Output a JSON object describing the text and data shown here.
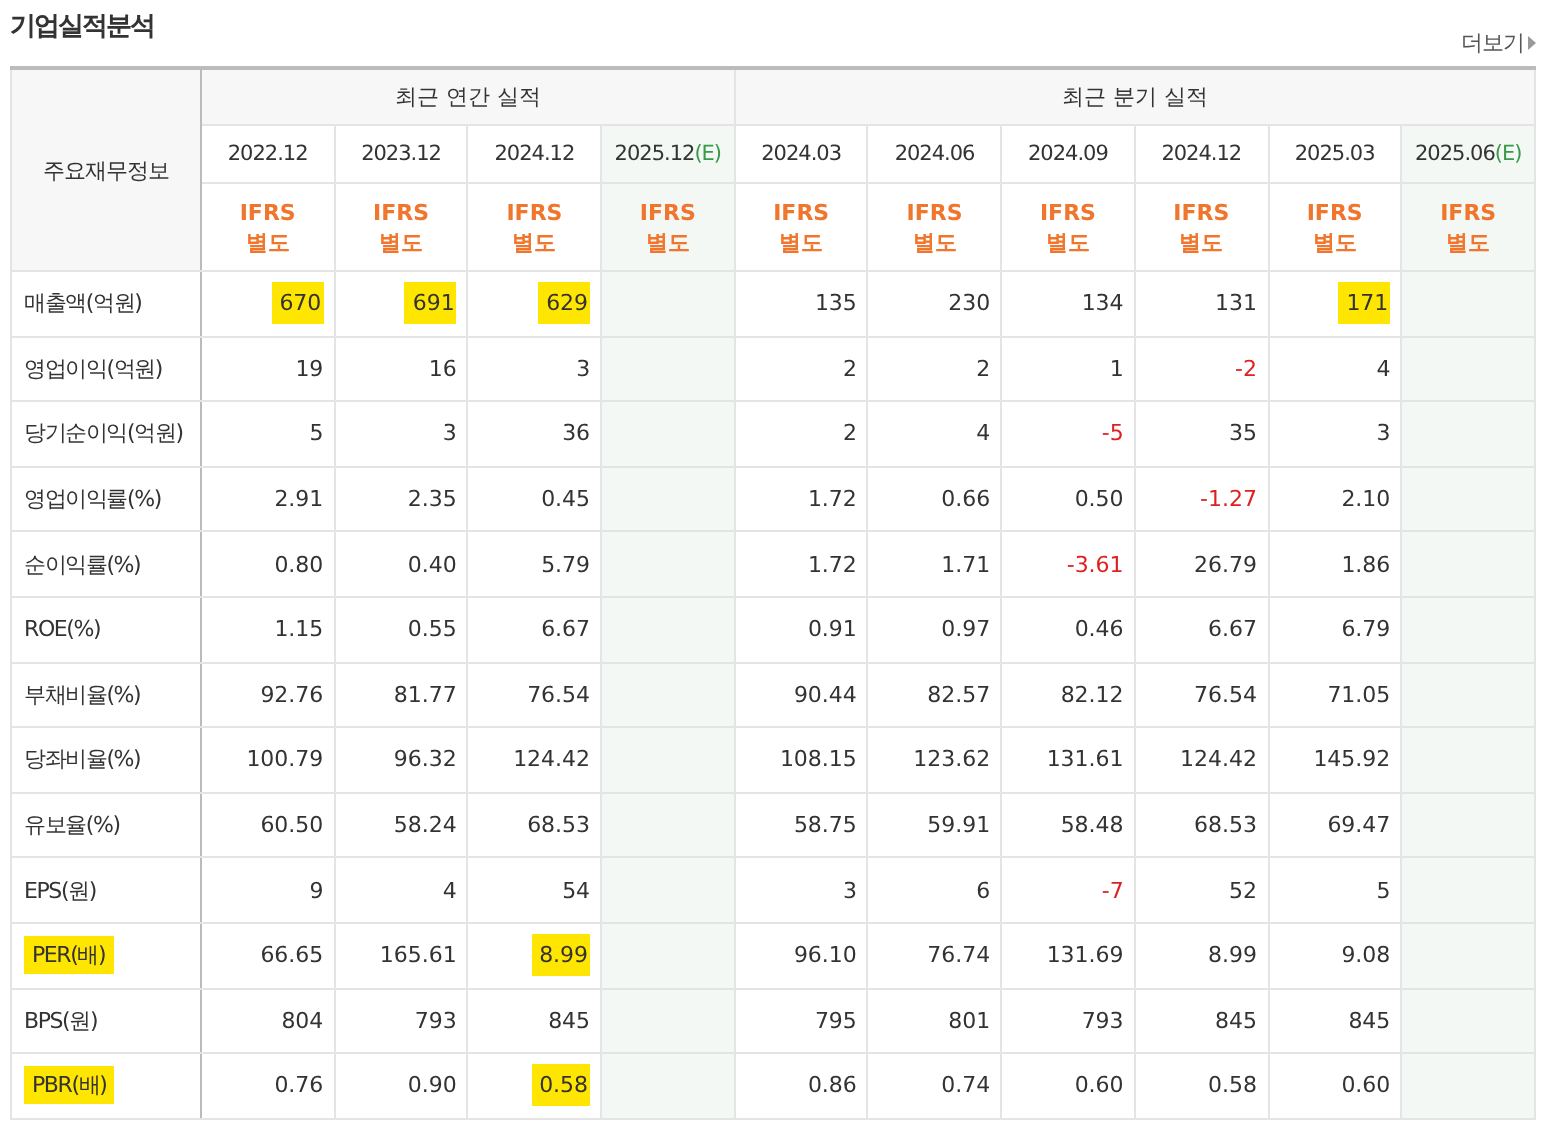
{
  "title": "기업실적분석",
  "more_link": "더보기",
  "corner_label": "주요재무정보",
  "groups": [
    {
      "label": "최근 연간 실적",
      "columns": [
        {
          "period": "2022.12",
          "estimate": false,
          "standard": [
            "IFRS",
            "별도"
          ]
        },
        {
          "period": "2023.12",
          "estimate": false,
          "standard": [
            "IFRS",
            "별도"
          ]
        },
        {
          "period": "2024.12",
          "estimate": false,
          "standard": [
            "IFRS",
            "별도"
          ]
        },
        {
          "period": "2025.12",
          "suffix": "(E)",
          "estimate": true,
          "standard": [
            "IFRS",
            "별도"
          ]
        }
      ]
    },
    {
      "label": "최근 분기 실적",
      "columns": [
        {
          "period": "2024.03",
          "estimate": false,
          "standard": [
            "IFRS",
            "별도"
          ]
        },
        {
          "period": "2024.06",
          "estimate": false,
          "standard": [
            "IFRS",
            "별도"
          ]
        },
        {
          "period": "2024.09",
          "estimate": false,
          "standard": [
            "IFRS",
            "별도"
          ]
        },
        {
          "period": "2024.12",
          "estimate": false,
          "standard": [
            "IFRS",
            "별도"
          ]
        },
        {
          "period": "2025.03",
          "estimate": false,
          "standard": [
            "IFRS",
            "별도"
          ]
        },
        {
          "period": "2025.06",
          "suffix": "(E)",
          "estimate": true,
          "standard": [
            "IFRS",
            "별도"
          ]
        }
      ]
    }
  ],
  "row_groups": [
    [
      {
        "label": "매출액(억원)",
        "highlighted": false,
        "values": [
          {
            "text": "670",
            "highlighted": true,
            "negative": false
          },
          {
            "text": "691",
            "highlighted": true,
            "negative": false
          },
          {
            "text": "629",
            "highlighted": true,
            "negative": false
          },
          {
            "text": "135",
            "highlighted": false,
            "negative": false
          },
          {
            "text": "230",
            "highlighted": false,
            "negative": false
          },
          {
            "text": "134",
            "highlighted": false,
            "negative": false
          },
          {
            "text": "131",
            "highlighted": false,
            "negative": false
          },
          {
            "text": "171",
            "highlighted": true,
            "negative": false
          }
        ]
      },
      {
        "label": "영업이익(억원)",
        "highlighted": false,
        "values": [
          {
            "text": "19",
            "highlighted": false,
            "negative": false
          },
          {
            "text": "16",
            "highlighted": false,
            "negative": false
          },
          {
            "text": "3",
            "highlighted": false,
            "negative": false
          },
          {
            "text": "2",
            "highlighted": false,
            "negative": false
          },
          {
            "text": "2",
            "highlighted": false,
            "negative": false
          },
          {
            "text": "1",
            "highlighted": false,
            "negative": false
          },
          {
            "text": "-2",
            "highlighted": false,
            "negative": true
          },
          {
            "text": "4",
            "highlighted": false,
            "negative": false
          }
        ]
      },
      {
        "label": "당기순이익(억원)",
        "highlighted": false,
        "values": [
          {
            "text": "5",
            "highlighted": false,
            "negative": false
          },
          {
            "text": "3",
            "highlighted": false,
            "negative": false
          },
          {
            "text": "36",
            "highlighted": false,
            "negative": false
          },
          {
            "text": "2",
            "highlighted": false,
            "negative": false
          },
          {
            "text": "4",
            "highlighted": false,
            "negative": false
          },
          {
            "text": "-5",
            "highlighted": false,
            "negative": true
          },
          {
            "text": "35",
            "highlighted": false,
            "negative": false
          },
          {
            "text": "3",
            "highlighted": false,
            "negative": false
          }
        ]
      }
    ],
    [
      {
        "label": "영업이익률(%)",
        "highlighted": false,
        "values": [
          {
            "text": "2.91",
            "highlighted": false,
            "negative": false
          },
          {
            "text": "2.35",
            "highlighted": false,
            "negative": false
          },
          {
            "text": "0.45",
            "highlighted": false,
            "negative": false
          },
          {
            "text": "1.72",
            "highlighted": false,
            "negative": false
          },
          {
            "text": "0.66",
            "highlighted": false,
            "negative": false
          },
          {
            "text": "0.50",
            "highlighted": false,
            "negative": false
          },
          {
            "text": "-1.27",
            "highlighted": false,
            "negative": true
          },
          {
            "text": "2.10",
            "highlighted": false,
            "negative": false
          }
        ]
      },
      {
        "label": "순이익률(%)",
        "highlighted": false,
        "values": [
          {
            "text": "0.80",
            "highlighted": false,
            "negative": false
          },
          {
            "text": "0.40",
            "highlighted": false,
            "negative": false
          },
          {
            "text": "5.79",
            "highlighted": false,
            "negative": false
          },
          {
            "text": "1.72",
            "highlighted": false,
            "negative": false
          },
          {
            "text": "1.71",
            "highlighted": false,
            "negative": false
          },
          {
            "text": "-3.61",
            "highlighted": false,
            "negative": true
          },
          {
            "text": "26.79",
            "highlighted": false,
            "negative": false
          },
          {
            "text": "1.86",
            "highlighted": false,
            "negative": false
          }
        ]
      },
      {
        "label": "ROE(%)",
        "highlighted": false,
        "values": [
          {
            "text": "1.15",
            "highlighted": false,
            "negative": false
          },
          {
            "text": "0.55",
            "highlighted": false,
            "negative": false
          },
          {
            "text": "6.67",
            "highlighted": false,
            "negative": false
          },
          {
            "text": "0.91",
            "highlighted": false,
            "negative": false
          },
          {
            "text": "0.97",
            "highlighted": false,
            "negative": false
          },
          {
            "text": "0.46",
            "highlighted": false,
            "negative": false
          },
          {
            "text": "6.67",
            "highlighted": false,
            "negative": false
          },
          {
            "text": "6.79",
            "highlighted": false,
            "negative": false
          }
        ]
      }
    ],
    [
      {
        "label": "부채비율(%)",
        "highlighted": false,
        "values": [
          {
            "text": "92.76",
            "highlighted": false,
            "negative": false
          },
          {
            "text": "81.77",
            "highlighted": false,
            "negative": false
          },
          {
            "text": "76.54",
            "highlighted": false,
            "negative": false
          },
          {
            "text": "90.44",
            "highlighted": false,
            "negative": false
          },
          {
            "text": "82.57",
            "highlighted": false,
            "negative": false
          },
          {
            "text": "82.12",
            "highlighted": false,
            "negative": false
          },
          {
            "text": "76.54",
            "highlighted": false,
            "negative": false
          },
          {
            "text": "71.05",
            "highlighted": false,
            "negative": false
          }
        ]
      },
      {
        "label": "당좌비율(%)",
        "highlighted": false,
        "values": [
          {
            "text": "100.79",
            "highlighted": false,
            "negative": false
          },
          {
            "text": "96.32",
            "highlighted": false,
            "negative": false
          },
          {
            "text": "124.42",
            "highlighted": false,
            "negative": false
          },
          {
            "text": "108.15",
            "highlighted": false,
            "negative": false
          },
          {
            "text": "123.62",
            "highlighted": false,
            "negative": false
          },
          {
            "text": "131.61",
            "highlighted": false,
            "negative": false
          },
          {
            "text": "124.42",
            "highlighted": false,
            "negative": false
          },
          {
            "text": "145.92",
            "highlighted": false,
            "negative": false
          }
        ]
      },
      {
        "label": "유보율(%)",
        "highlighted": false,
        "values": [
          {
            "text": "60.50",
            "highlighted": false,
            "negative": false
          },
          {
            "text": "58.24",
            "highlighted": false,
            "negative": false
          },
          {
            "text": "68.53",
            "highlighted": false,
            "negative": false
          },
          {
            "text": "58.75",
            "highlighted": false,
            "negative": false
          },
          {
            "text": "59.91",
            "highlighted": false,
            "negative": false
          },
          {
            "text": "58.48",
            "highlighted": false,
            "negative": false
          },
          {
            "text": "68.53",
            "highlighted": false,
            "negative": false
          },
          {
            "text": "69.47",
            "highlighted": false,
            "negative": false
          }
        ]
      }
    ],
    [
      {
        "label": "EPS(원)",
        "highlighted": false,
        "values": [
          {
            "text": "9",
            "highlighted": false,
            "negative": false
          },
          {
            "text": "4",
            "highlighted": false,
            "negative": false
          },
          {
            "text": "54",
            "highlighted": false,
            "negative": false
          },
          {
            "text": "3",
            "highlighted": false,
            "negative": false
          },
          {
            "text": "6",
            "highlighted": false,
            "negative": false
          },
          {
            "text": "-7",
            "highlighted": false,
            "negative": true
          },
          {
            "text": "52",
            "highlighted": false,
            "negative": false
          },
          {
            "text": "5",
            "highlighted": false,
            "negative": false
          }
        ]
      },
      {
        "label": "PER(배)",
        "highlighted": true,
        "values": [
          {
            "text": "66.65",
            "highlighted": false,
            "negative": false
          },
          {
            "text": "165.61",
            "highlighted": false,
            "negative": false
          },
          {
            "text": "8.99",
            "highlighted": true,
            "negative": false
          },
          {
            "text": "96.10",
            "highlighted": false,
            "negative": false
          },
          {
            "text": "76.74",
            "highlighted": false,
            "negative": false
          },
          {
            "text": "131.69",
            "highlighted": false,
            "negative": false
          },
          {
            "text": "8.99",
            "highlighted": false,
            "negative": false
          },
          {
            "text": "9.08",
            "highlighted": false,
            "negative": false
          }
        ]
      },
      {
        "label": "BPS(원)",
        "highlighted": false,
        "values": [
          {
            "text": "804",
            "highlighted": false,
            "negative": false
          },
          {
            "text": "793",
            "highlighted": false,
            "negative": false
          },
          {
            "text": "845",
            "highlighted": false,
            "negative": false
          },
          {
            "text": "795",
            "highlighted": false,
            "negative": false
          },
          {
            "text": "801",
            "highlighted": false,
            "negative": false
          },
          {
            "text": "793",
            "highlighted": false,
            "negative": false
          },
          {
            "text": "845",
            "highlighted": false,
            "negative": false
          },
          {
            "text": "845",
            "highlighted": false,
            "negative": false
          }
        ]
      },
      {
        "label": "PBR(배)",
        "highlighted": true,
        "values": [
          {
            "text": "0.76",
            "highlighted": false,
            "negative": false
          },
          {
            "text": "0.90",
            "highlighted": false,
            "negative": false
          },
          {
            "text": "0.58",
            "highlighted": true,
            "negative": false
          },
          {
            "text": "0.86",
            "highlighted": false,
            "negative": false
          },
          {
            "text": "0.74",
            "highlighted": false,
            "negative": false
          },
          {
            "text": "0.60",
            "highlighted": false,
            "negative": false
          },
          {
            "text": "0.58",
            "highlighted": false,
            "negative": false
          },
          {
            "text": "0.60",
            "highlighted": false,
            "negative": false
          }
        ]
      }
    ]
  ]
}
